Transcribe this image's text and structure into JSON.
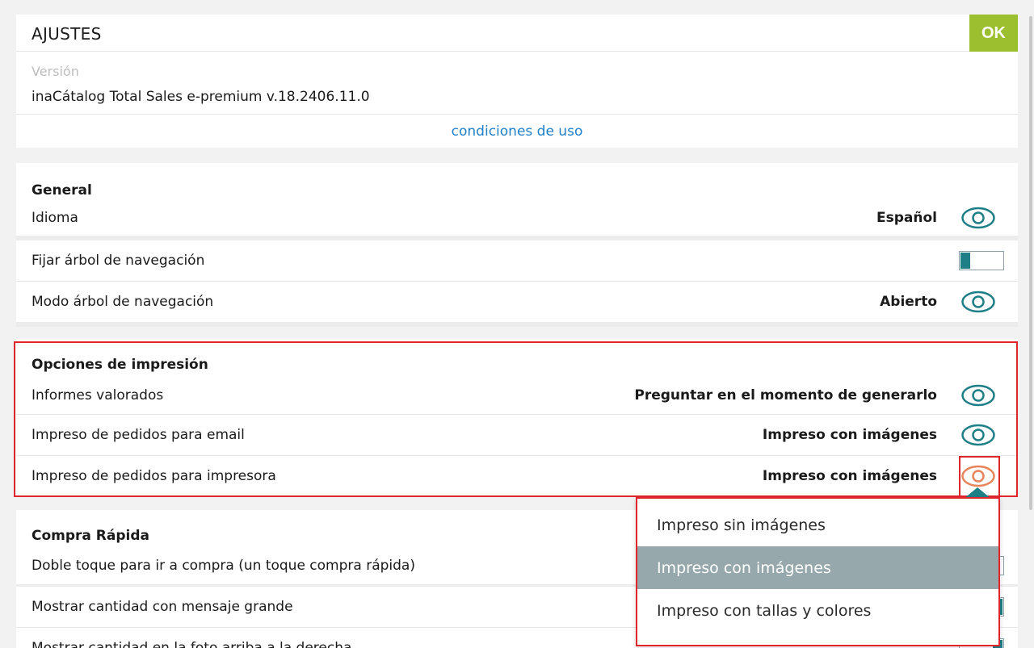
{
  "header": {
    "title": "AJUSTES",
    "ok_label": "OK"
  },
  "version": {
    "label": "Versión",
    "value": "inaCátalog Total Sales e-premium v.18.2406.11.0",
    "terms_link": "condiciones de uso"
  },
  "general": {
    "title": "General",
    "language": {
      "label": "Idioma",
      "value": "Español"
    },
    "pin_tree": {
      "label": "Fijar árbol de navegación"
    },
    "tree_mode": {
      "label": "Modo árbol de navegación",
      "value": "Abierto"
    }
  },
  "print": {
    "title": "Opciones de impresión",
    "valued_reports": {
      "label": "Informes valorados",
      "value": "Preguntar en el momento de generarlo"
    },
    "email_orders": {
      "label": "Impreso de pedidos para email",
      "value": "Impreso con imágenes"
    },
    "printer_orders": {
      "label": "Impreso de pedidos para impresora",
      "value": "Impreso con imágenes"
    }
  },
  "quick": {
    "title": "Compra Rápida",
    "double_tap": {
      "label": "Doble toque para ir a compra (un toque compra rápida)"
    },
    "big_qty": {
      "label": "Mostrar cantidad con mensaje grande"
    },
    "photo_qty": {
      "label": "Mostrar cantidad en la foto arriba a la derecha"
    }
  },
  "dropdown": {
    "options": [
      "Impreso sin imágenes",
      "Impreso con imágenes",
      "Impreso con tallas y colores"
    ],
    "selected_index": 1
  },
  "colors": {
    "accent": "#1f7f87",
    "ok": "#9bbf2f",
    "highlight": "#e0262a",
    "eye_active": "#e8845a"
  }
}
